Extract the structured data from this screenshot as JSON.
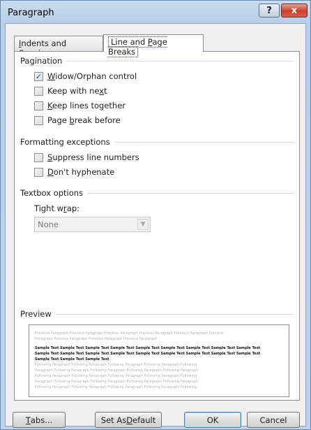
{
  "window": {
    "title": "Paragraph",
    "help_glyph": "?",
    "close_glyph": "x"
  },
  "tabs": [
    {
      "label_pre": "",
      "label_u": "I",
      "label_post": "ndents and Spacing"
    },
    {
      "label_pre": "Line and ",
      "label_u": "P",
      "label_post": "age Breaks"
    }
  ],
  "pagination": {
    "heading": "Pagination",
    "items": [
      {
        "pre": "",
        "u": "W",
        "post": "idow/Orphan control",
        "checked": true
      },
      {
        "pre": "Keep with ne",
        "u": "x",
        "post": "t",
        "checked": false
      },
      {
        "pre": "",
        "u": "K",
        "post": "eep lines together",
        "checked": false
      },
      {
        "pre": "Page ",
        "u": "b",
        "post": "reak before",
        "checked": false
      }
    ]
  },
  "formatting": {
    "heading": "Formatting exceptions",
    "items": [
      {
        "pre": "",
        "u": "S",
        "post": "uppress line numbers",
        "checked": false
      },
      {
        "pre": "",
        "u": "D",
        "post": "on't hyphenate",
        "checked": false
      }
    ]
  },
  "textbox": {
    "heading": "Textbox options",
    "tight_wrap_pre": "Tight w",
    "tight_wrap_u": "r",
    "tight_wrap_post": "ap:",
    "tight_wrap_value": "None"
  },
  "preview": {
    "heading": "Preview",
    "prev_lines": [
      "Previous Paragraph Previous Paragraph Previous Paragraph Previous Paragraph Previous Paragraph Previous",
      "Paragraph Previous Paragraph Previous Paragraph Previous Paragraph"
    ],
    "sample_lines": [
      "Sample Text Sample Text Sample Text Sample Text Sample Text Sample Text Sample Text Sample Text Sample Text",
      "Sample Text Sample Text Sample Text Sample Text Sample Text Sample Text Sample Text Sample Text Sample Text",
      "Sample Text Sample Text Sample Text"
    ],
    "follow_lines": [
      "Following Paragraph Following Paragraph Following Paragraph Following Paragraph Following",
      "Paragraph Following Paragraph Following Paragraph Following Paragraph Following Paragraph",
      "Following Paragraph Following Paragraph Following Paragraph Following Paragraph Following",
      "Paragraph Following Paragraph Following Paragraph Following Paragraph Following Paragraph",
      "Following Paragraph Following Paragraph Following Paragraph Following Paragraph Following"
    ]
  },
  "buttons": {
    "tabs": {
      "u": "T",
      "post": "abs..."
    },
    "set_default": {
      "pre": "Set As ",
      "u": "D",
      "post": "efault"
    },
    "ok": "OK",
    "cancel": "Cancel"
  }
}
